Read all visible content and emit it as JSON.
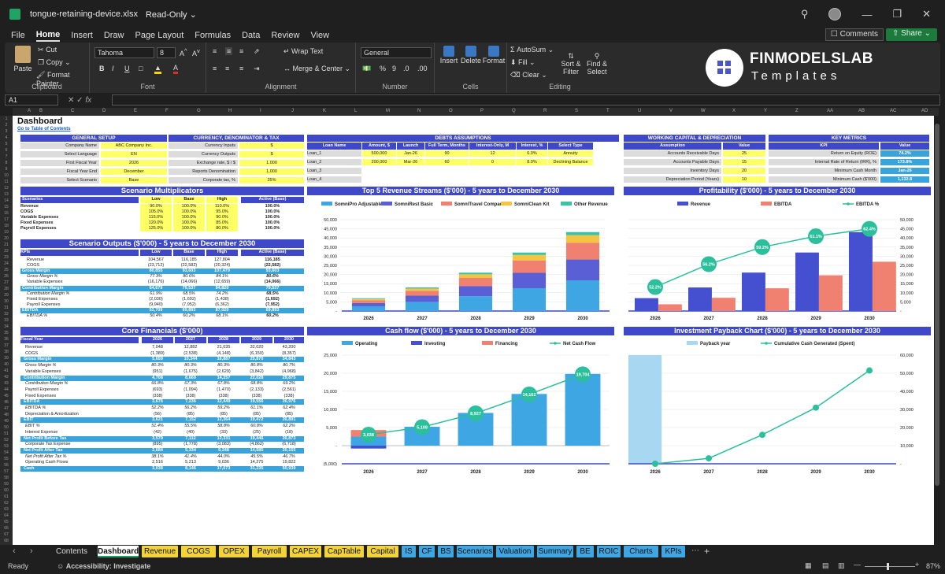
{
  "window": {
    "filename": "tongue-retaining-device.xlsx",
    "mode": "Read-Only"
  },
  "menu": [
    "File",
    "Home",
    "Insert",
    "Draw",
    "Page Layout",
    "Formulas",
    "Data",
    "Review",
    "View"
  ],
  "menu_active": "Home",
  "buttons": {
    "comments": "Comments",
    "share": "Share"
  },
  "ribbon": {
    "clipboard": {
      "paste": "Paste",
      "cut": "Cut",
      "copy": "Copy",
      "format_painter": "Format Painter",
      "label": "Clipboard"
    },
    "font": {
      "name": "Tahoma",
      "size": "8",
      "label": "Font"
    },
    "alignment": {
      "wrap": "Wrap Text",
      "merge": "Merge & Center",
      "label": "Alignment"
    },
    "number": {
      "format": "General",
      "label": "Number"
    },
    "cells": {
      "insert": "Insert",
      "delete": "Delete",
      "format": "Format",
      "label": "Cells"
    },
    "editing": {
      "autosum": "AutoSum",
      "fill": "Fill",
      "clear": "Clear",
      "sort": "Sort & Filter",
      "find": "Find & Select",
      "label": "Editing"
    }
  },
  "logo": {
    "line1": "FINMODELSLAB",
    "line2": "Templates"
  },
  "formula_bar": {
    "cell_ref": "A1",
    "formula": ""
  },
  "col_letters": [
    "A",
    "B",
    "C",
    "D",
    "E",
    "F",
    "G",
    "H",
    "I",
    "J",
    "K",
    "L",
    "M",
    "N",
    "O",
    "P",
    "Q",
    "R",
    "S",
    "T",
    "U",
    "V",
    "W",
    "X",
    "Y",
    "Z",
    "AA",
    "AB",
    "AC",
    "AD"
  ],
  "dashboard": {
    "title": "Dashboard",
    "toc_link": "Go to Table of Contents",
    "general_setup": {
      "header": "GENERAL SETUP",
      "rows": [
        [
          "Company Name",
          "ABC Company Inc."
        ],
        [
          "Select Language",
          "EN"
        ],
        [
          "First Fiscal Year",
          "2026"
        ],
        [
          "Fiscal Year End",
          "December"
        ],
        [
          "Select Scenario",
          "Base"
        ]
      ]
    },
    "currency": {
      "header": "CURRENCY, DENOMINATOR & TAX",
      "rows": [
        [
          "Currency Inputs",
          "$"
        ],
        [
          "Currency Outputs",
          "$"
        ],
        [
          "Exchange rate, $ / $",
          "1.000"
        ],
        [
          "Reports Denomination",
          "1,000"
        ],
        [
          "Corporate tax, %",
          "25%"
        ]
      ]
    },
    "debts": {
      "header": "DEBTS ASSUMPTIONS",
      "cols": [
        "Loan Name",
        "Amount, $",
        "Launch",
        "Full Term, Months",
        "Interest-Only, M",
        "Interest, %",
        "Select Type"
      ],
      "rows": [
        [
          "Loan_1",
          "500,000",
          "Jan-26",
          "90",
          "12",
          "6.0%",
          "Annuity"
        ],
        [
          "Loan_2",
          "200,000",
          "Mar-26",
          "60",
          "0",
          "8.0%",
          "Declining Balance"
        ],
        [
          "Loan_3",
          "",
          "",
          "",
          "",
          "",
          ""
        ],
        [
          "Loan_4",
          "",
          "",
          "",
          "",
          "",
          ""
        ]
      ]
    },
    "working_capital": {
      "header": "WORKING CAPITAL & DEPRECIATION",
      "cols": [
        "Assumption",
        "Value"
      ],
      "rows": [
        [
          "Accounts Receivable Days",
          "25"
        ],
        [
          "Accounts Payable Days",
          "15"
        ],
        [
          "Inventory Days",
          "20"
        ],
        [
          "Depreciation Period (Years)",
          "10"
        ]
      ]
    },
    "kpis": {
      "header": "KEY METRICS",
      "cols": [
        "KPI",
        "Value"
      ],
      "rows": [
        [
          "Return on Equity (ROE)",
          "74.2%"
        ],
        [
          "Internal Rate of Return (IRR), %",
          "173.8%"
        ],
        [
          "Minimum Cash Month",
          "Jan-26"
        ],
        [
          "Minimum Cash ($'000)",
          "1,132.8"
        ]
      ]
    },
    "scenario_mult": {
      "header": "Scenario Multiplicators",
      "cols": [
        "Scenarios",
        "Low",
        "Base",
        "High",
        "Active (Base)"
      ],
      "rows": [
        [
          "Revenue",
          "90.0%",
          "100.0%",
          "110.0%",
          "100.0%"
        ],
        [
          "COGS",
          "105.0%",
          "100.0%",
          "95.0%",
          "100.0%"
        ],
        [
          "Variable Expenses",
          "115.0%",
          "100.0%",
          "90.0%",
          "100.0%"
        ],
        [
          "Fixed Expenses",
          "120.0%",
          "100.0%",
          "85.0%",
          "100.0%"
        ],
        [
          "Payroll Expenses",
          "125.0%",
          "100.0%",
          "80.0%",
          "100.0%"
        ]
      ]
    },
    "scenario_out": {
      "header": "Scenario Outputs ($'000) - 5 years to December 2030",
      "cols": [
        "KPIs",
        "Low",
        "Base",
        "High",
        "Active (Base)"
      ],
      "rows": [
        [
          "Revenue",
          "104,567",
          "116,185",
          "127,804",
          "116,185",
          "n"
        ],
        [
          "COGS",
          "(23,712)",
          "(22,582)",
          "(20,324)",
          "(22,582)",
          "n"
        ],
        [
          "Gross Margin",
          "80,855",
          "93,603",
          "107,479",
          "93,603",
          "h"
        ],
        [
          "Gross Margin %",
          "77.3%",
          "80.6%",
          "84.1%",
          "80.6%",
          "i"
        ],
        [
          "Variable Expenses",
          "(16,176)",
          "(14,066)",
          "(12,659)",
          "(14,066)",
          "n"
        ],
        [
          "Contribution Margin",
          "64,679",
          "79,537",
          "94,820",
          "79,537",
          "h"
        ],
        [
          "Contribution Margin %",
          "61.9%",
          "68.5%",
          "74.2%",
          "68.5%",
          "i"
        ],
        [
          "Fixed Expenses",
          "(2,030)",
          "(1,692)",
          "(1,438)",
          "(1,692)",
          "n"
        ],
        [
          "Payroll Expenses",
          "(9,940)",
          "(7,952)",
          "(6,362)",
          "(7,952)",
          "n"
        ],
        [
          "EBITDA",
          "52,709",
          "69,893",
          "87,020",
          "69,893",
          "h"
        ],
        [
          "EBITDA %",
          "50.4%",
          "60.2%",
          "68.1%",
          "60.2%",
          "i"
        ]
      ]
    },
    "core": {
      "header": "Core Financials ($'000)",
      "cols": [
        "Fiscal Year",
        "2026",
        "2027",
        "2028",
        "2029",
        "2030"
      ],
      "rows": [
        [
          "Revenue",
          "7,048",
          "12,882",
          "21,035",
          "32,020",
          "43,200",
          "n"
        ],
        [
          "COGS",
          "(1,389)",
          "(2,538)",
          "(4,148)",
          "(6,150)",
          "(8,357)",
          "n"
        ],
        [
          "Gross Margin",
          "5,659",
          "10,344",
          "16,887",
          "25,870",
          "34,843",
          "h"
        ],
        [
          "Gross Margin %",
          "80.3%",
          "80.3%",
          "80.3%",
          "80.8%",
          "80.7%",
          "i"
        ],
        [
          "Variable Expenses",
          "(951)",
          "(1,675)",
          "(2,629)",
          "(3,842)",
          "(4,968)",
          "n"
        ],
        [
          "Contribution Margin",
          "4,708",
          "8,669",
          "14,257",
          "22,028",
          "29,875",
          "h"
        ],
        [
          "Contribution Margin %",
          "66.8%",
          "67.3%",
          "67.8%",
          "68.8%",
          "69.2%",
          "i"
        ],
        [
          "Payroll Expenses",
          "(693)",
          "(1,094)",
          "(1,470)",
          "(2,133)",
          "(2,561)",
          "n"
        ],
        [
          "Fixed Expenses",
          "(338)",
          "(338)",
          "(338)",
          "(338)",
          "(338)",
          "n"
        ],
        [
          "EBITDA",
          "3,676",
          "7,236",
          "12,449",
          "19,556",
          "26,976",
          "h"
        ],
        [
          "EBITDA %",
          "52.2%",
          "56.2%",
          "59.2%",
          "61.1%",
          "62.4%",
          "i"
        ],
        [
          "Depreciation & Amortization",
          "(56)",
          "(85)",
          "(85)",
          "(85)",
          "(85)",
          "n"
        ],
        [
          "EBIT",
          "3,621",
          "7,152",
          "12,364",
          "19,472",
          "26,891",
          "h"
        ],
        [
          "EBIT %",
          "51.4%",
          "55.5%",
          "58.8%",
          "60.8%",
          "62.2%",
          "i"
        ],
        [
          "Interest Expense",
          "(42)",
          "(40)",
          "(33)",
          "(25)",
          "(18)",
          "n"
        ],
        [
          "Net Profit Before Tax",
          "3,579",
          "7,112",
          "12,331",
          "19,446",
          "26,873",
          "h"
        ],
        [
          "Corporate Tax Expense",
          "(895)",
          "(1,778)",
          "(3,083)",
          "(4,862)",
          "(6,718)",
          "n"
        ],
        [
          "Net Profit After Tax",
          "2,684",
          "5,334",
          "9,248",
          "14,585",
          "20,155",
          "h"
        ],
        [
          "Net Profit After Tax %",
          "38.1%",
          "41.4%",
          "44.0%",
          "45.5%",
          "46.7%",
          "i"
        ],
        [
          "Operating Cash Flows",
          "2,516",
          "5,213",
          "9,036",
          "14,275",
          "19,822",
          "n"
        ],
        [
          "Cash",
          "3,038",
          "8,146",
          "17,073",
          "31,235",
          "50,939",
          "h"
        ]
      ]
    }
  },
  "charts": {
    "revenue_streams": {
      "title": "Top 5 Revenue Streams ($'000) - 5 years to December 2030"
    },
    "profitability": {
      "title": "Profitability ($'000) - 5 years to December 2030"
    },
    "cashflow": {
      "title": "Cash flow ($'000) - 5 years to December 2030"
    },
    "payback": {
      "title": "Investment Payback Chart ($'000) - 5 years to December 2030"
    }
  },
  "chart_data": [
    {
      "type": "bar",
      "stacked": true,
      "title": "Top 5 Revenue Streams ($'000) - 5 years to December 2030",
      "categories": [
        "2026",
        "2027",
        "2028",
        "2029",
        "2030"
      ],
      "ylim": [
        0,
        50000
      ],
      "yticks": [
        "-",
        "5,000",
        "10,000",
        "15,000",
        "20,000",
        "25,000",
        "30,000",
        "35,000",
        "40,000",
        "45,000",
        "50,000"
      ],
      "series": [
        {
          "name": "SomniPro Adjustable",
          "color": "#3ea6e3",
          "values": [
            2600,
            5000,
            8100,
            12500,
            16800
          ]
        },
        {
          "name": "SomniRest Basic",
          "color": "#5a5fd6",
          "values": [
            1800,
            3400,
            5500,
            8400,
            11400
          ]
        },
        {
          "name": "SomniTravel Compact",
          "color": "#f08070",
          "values": [
            1500,
            2700,
            4500,
            6800,
            9200
          ]
        },
        {
          "name": "SomniClean Kit",
          "color": "#f5c542",
          "values": [
            700,
            1200,
            2000,
            3000,
            4100
          ]
        },
        {
          "name": "Other Revenue",
          "color": "#3cc2a4",
          "values": [
            400,
            600,
            900,
            1300,
            1700
          ]
        }
      ],
      "legend": "top"
    },
    {
      "type": "bar+line",
      "title": "Profitability ($'000) - 5 years to December 2030",
      "categories": [
        "2026",
        "2027",
        "2028",
        "2029",
        "2030"
      ],
      "ylim": [
        0,
        50000
      ],
      "yticks": [
        "-",
        "5,000",
        "10,000",
        "15,000",
        "20,000",
        "25,000",
        "30,000",
        "35,000",
        "40,000",
        "45,000",
        "50,000"
      ],
      "series": [
        {
          "name": "Revenue",
          "color": "#4450d0",
          "values": [
            7048,
            12882,
            21035,
            32020,
            43200
          ]
        },
        {
          "name": "EBITDA",
          "color": "#f08070",
          "values": [
            3676,
            7236,
            12449,
            19556,
            26976
          ]
        },
        {
          "name": "EBITDA %",
          "color": "#2bbf9c",
          "values": [
            52.2,
            56.2,
            59.2,
            61.1,
            62.4
          ],
          "labels": [
            "52.2%",
            "56.2%",
            "59.2%",
            "61.1%",
            "62.4%"
          ]
        }
      ],
      "legend": "top"
    },
    {
      "type": "bar+line",
      "title": "Cash flow ($'000) - 5 years to December 2030",
      "categories": [
        "2026",
        "2027",
        "2028",
        "2029",
        "2030"
      ],
      "ylim": [
        -5000,
        25000
      ],
      "yticks": [
        "(5,000)",
        "-",
        "5,000",
        "10,000",
        "15,000",
        "20,000",
        "25,000"
      ],
      "series": [
        {
          "name": "Operating",
          "color": "#3ea6e3",
          "values": [
            2516,
            5213,
            9036,
            14275,
            19822
          ]
        },
        {
          "name": "Investing",
          "color": "#4450d0",
          "values": [
            -800,
            0,
            0,
            0,
            0
          ]
        },
        {
          "name": "Financing",
          "color": "#f08070",
          "values": [
            1800,
            0,
            0,
            0,
            0
          ]
        },
        {
          "name": "Net Cash Flow",
          "color": "#2bbf9c",
          "values": [
            3038,
            5108,
            8927,
            14162,
            19704
          ],
          "labels": [
            "3,038",
            "5,108",
            "8,927",
            "14,162",
            "19,704"
          ]
        }
      ],
      "legend": "top"
    },
    {
      "type": "bar+line",
      "title": "Investment Payback Chart ($'000) - 5 years to December 2030",
      "categories": [
        "2026",
        "2027",
        "2028",
        "2029",
        "2030"
      ],
      "ylim": [
        0,
        60000
      ],
      "yticks": [
        "-",
        "10,000",
        "20,000",
        "30,000",
        "40,000",
        "50,000",
        "60,000"
      ],
      "series": [
        {
          "name": "Payback year",
          "color": "#a8d7f2",
          "values": [
            60000,
            0,
            0,
            0,
            0
          ]
        },
        {
          "name": "Cumulative Cash Generated (Spent)",
          "color": "#2bbf9c",
          "values": [
            0,
            3000,
            16000,
            31000,
            51500
          ]
        }
      ],
      "legend": "top"
    }
  ],
  "sheet_tabs": [
    {
      "name": "Contents",
      "color": "#1f1f1f",
      "fg": "#ddd"
    },
    {
      "name": "Dashboard",
      "color": "#ffffff",
      "fg": "#111",
      "active": true
    },
    {
      "name": "Revenue",
      "color": "#f2d338"
    },
    {
      "name": "COGS",
      "color": "#f2d338"
    },
    {
      "name": "OPEX",
      "color": "#f2d338"
    },
    {
      "name": "Payroll",
      "color": "#f2d338"
    },
    {
      "name": "CAPEX",
      "color": "#f2d338"
    },
    {
      "name": "CapTable",
      "color": "#f2d338"
    },
    {
      "name": "Capital",
      "color": "#f2d338"
    },
    {
      "name": "IS",
      "color": "#3ea6e3"
    },
    {
      "name": "CF",
      "color": "#3ea6e3"
    },
    {
      "name": "BS",
      "color": "#3ea6e3"
    },
    {
      "name": "Scenarios",
      "color": "#3ea6e3"
    },
    {
      "name": "Valuation",
      "color": "#3ea6e3"
    },
    {
      "name": "Summary",
      "color": "#3ea6e3"
    },
    {
      "name": "BE",
      "color": "#3ea6e3"
    },
    {
      "name": "ROIC",
      "color": "#3ea6e3"
    },
    {
      "name": "Charts",
      "color": "#3ea6e3"
    },
    {
      "name": "KPIs",
      "color": "#3ea6e3"
    }
  ],
  "status": {
    "ready": "Ready",
    "accessibility": "Accessibility: Investigate",
    "zoom": "87%"
  }
}
